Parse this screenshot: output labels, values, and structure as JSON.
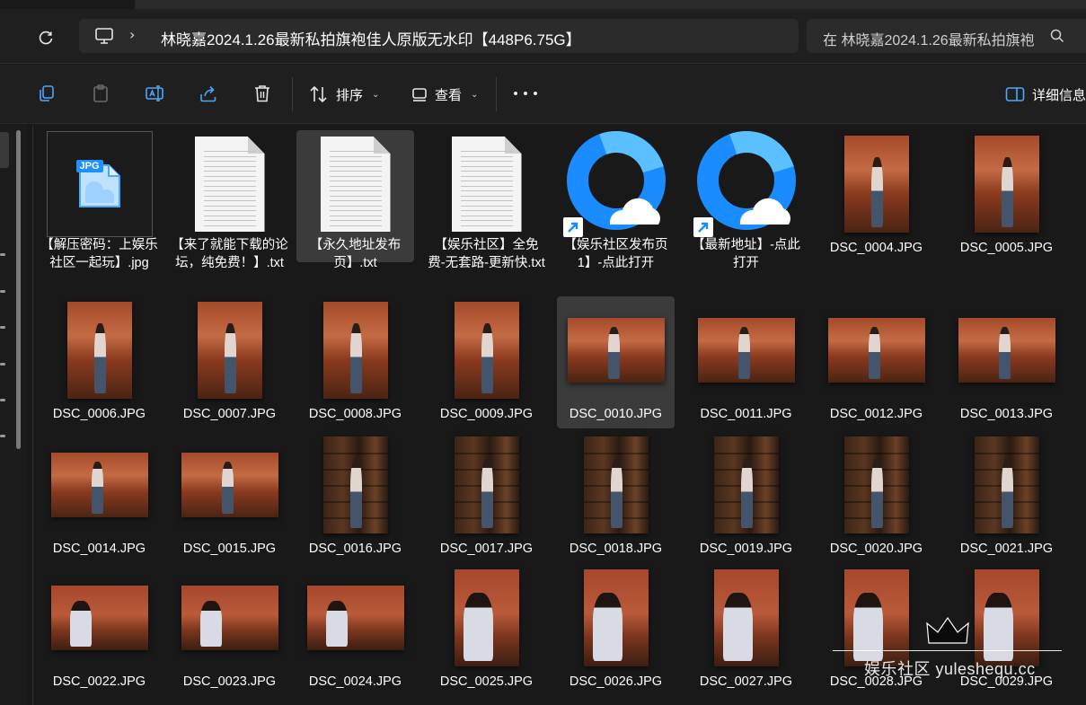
{
  "address": {
    "breadcrumb": "林晓嘉2024.1.26最新私拍旗袍佳人原版无水印【448P6.75G】",
    "search_placeholder": "在 林晓嘉2024.1.26最新私拍旗袍"
  },
  "toolbar": {
    "sort_label": "排序",
    "view_label": "查看",
    "details_label": "详细信息"
  },
  "icons": {
    "refresh": "refresh-icon",
    "monitor": "monitor-icon",
    "chevron": "chevron-right-icon",
    "search": "search-icon",
    "copy": "copy-icon",
    "paste": "paste-icon",
    "rename": "rename-icon",
    "share": "share-icon",
    "delete": "trash-icon",
    "sort": "sort-icon",
    "view": "view-icon",
    "more": "more-icon",
    "details": "details-pane-icon"
  },
  "files": [
    {
      "name": "【解压密码：上娱乐社区一起玩】.jpg",
      "kind": "jpg-icon",
      "selected": false
    },
    {
      "name": "【来了就能下载的论坛，纯免费！】.txt",
      "kind": "txt",
      "selected": false
    },
    {
      "name": "【永久地址发布页】.txt",
      "kind": "txt",
      "selected": true
    },
    {
      "name": "【娱乐社区】全免费-无套路-更新快.txt",
      "kind": "txt",
      "selected": false
    },
    {
      "name": "【娱乐社区发布页1】-点此打开",
      "kind": "shortcut",
      "selected": false
    },
    {
      "name": "【最新地址】-点此打开",
      "kind": "shortcut",
      "selected": false
    },
    {
      "name": "DSC_0004.JPG",
      "kind": "photo-portrait-room",
      "selected": false
    },
    {
      "name": "DSC_0005.JPG",
      "kind": "photo-portrait-room",
      "selected": false
    },
    {
      "name": "DSC_0006.JPG",
      "kind": "photo-portrait-room",
      "selected": false
    },
    {
      "name": "DSC_0007.JPG",
      "kind": "photo-portrait-room",
      "selected": false
    },
    {
      "name": "DSC_0008.JPG",
      "kind": "photo-portrait-room",
      "selected": false
    },
    {
      "name": "DSC_0009.JPG",
      "kind": "photo-portrait-room",
      "selected": false
    },
    {
      "name": "DSC_0010.JPG",
      "kind": "photo-landscape-room",
      "selected": true
    },
    {
      "name": "DSC_0011.JPG",
      "kind": "photo-landscape-room",
      "selected": false
    },
    {
      "name": "DSC_0012.JPG",
      "kind": "photo-landscape-room",
      "selected": false
    },
    {
      "name": "DSC_0013.JPG",
      "kind": "photo-landscape-room",
      "selected": false
    },
    {
      "name": "DSC_0014.JPG",
      "kind": "photo-landscape-room",
      "selected": false
    },
    {
      "name": "DSC_0015.JPG",
      "kind": "photo-landscape-room",
      "selected": false
    },
    {
      "name": "DSC_0016.JPG",
      "kind": "photo-portrait-lib",
      "selected": false
    },
    {
      "name": "DSC_0017.JPG",
      "kind": "photo-portrait-lib",
      "selected": false
    },
    {
      "name": "DSC_0018.JPG",
      "kind": "photo-portrait-lib",
      "selected": false
    },
    {
      "name": "DSC_0019.JPG",
      "kind": "photo-portrait-lib",
      "selected": false
    },
    {
      "name": "DSC_0020.JPG",
      "kind": "photo-portrait-lib",
      "selected": false
    },
    {
      "name": "DSC_0021.JPG",
      "kind": "photo-portrait-lib",
      "selected": false
    },
    {
      "name": "DSC_0022.JPG",
      "kind": "photo-landscape-desk",
      "selected": false
    },
    {
      "name": "DSC_0023.JPG",
      "kind": "photo-landscape-desk",
      "selected": false
    },
    {
      "name": "DSC_0024.JPG",
      "kind": "photo-landscape-desk",
      "selected": false
    },
    {
      "name": "DSC_0025.JPG",
      "kind": "photo-portrait-desk",
      "selected": false
    },
    {
      "name": "DSC_0026.JPG",
      "kind": "photo-portrait-desk",
      "selected": false
    },
    {
      "name": "DSC_0027.JPG",
      "kind": "photo-portrait-desk",
      "selected": false
    },
    {
      "name": "DSC_0028.JPG",
      "kind": "photo-portrait-desk",
      "selected": false
    },
    {
      "name": "DSC_0029.JPG",
      "kind": "photo-portrait-desk",
      "selected": false
    }
  ],
  "jpg_badge": "JPG",
  "watermark": "娱乐社区 yuleshequ.cc",
  "colors": {
    "background": "#191919",
    "selection": "#3b3b3b",
    "accent_blue": "#1e90ff"
  }
}
